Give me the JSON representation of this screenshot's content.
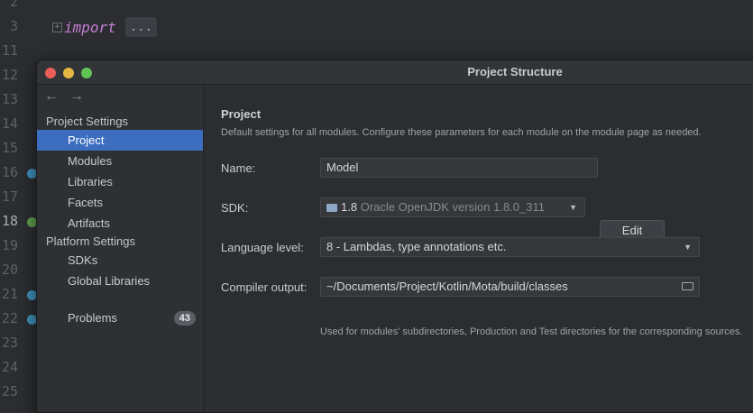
{
  "editor": {
    "line_numbers": [
      {
        "n": "2",
        "current": false
      },
      {
        "n": "3",
        "current": false
      },
      {
        "n": "11",
        "current": false
      },
      {
        "n": "12",
        "current": false
      },
      {
        "n": "13",
        "current": false
      },
      {
        "n": "14",
        "current": false
      },
      {
        "n": "15",
        "current": false
      },
      {
        "n": "16",
        "current": false
      },
      {
        "n": "17",
        "current": false
      },
      {
        "n": "18",
        "current": true
      },
      {
        "n": "19",
        "current": false
      },
      {
        "n": "20",
        "current": false
      },
      {
        "n": "21",
        "current": false
      },
      {
        "n": "22",
        "current": false
      },
      {
        "n": "23",
        "current": false
      },
      {
        "n": "24",
        "current": false
      },
      {
        "n": "25",
        "current": false
      }
    ],
    "import_keyword": "import",
    "collapsed_placeholder": "...",
    "gutter_markers": [
      "blue",
      "green",
      "blue",
      "blue"
    ]
  },
  "dialog": {
    "title": "Project Structure",
    "nav_back": "←",
    "nav_forward": "→",
    "sidebar": {
      "project_settings_header": "Project Settings",
      "project_items": [
        "Project",
        "Modules",
        "Libraries",
        "Facets",
        "Artifacts"
      ],
      "platform_settings_header": "Platform Settings",
      "platform_items": [
        "SDKs",
        "Global Libraries"
      ],
      "problems_label": "Problems",
      "problems_count": "43",
      "selected": "Project"
    },
    "content": {
      "heading": "Project",
      "description": "Default settings for all modules. Configure these parameters for each module on the module page as needed.",
      "name_label": "Name:",
      "name_value": "Model",
      "sdk_label": "SDK:",
      "sdk_version": "1.8",
      "sdk_detail": "Oracle OpenJDK version 1.8.0_311",
      "sdk_edit_button": "Edit",
      "language_level_label": "Language level:",
      "language_level_value": "8 - Lambdas, type annotations etc.",
      "compiler_output_label": "Compiler output:",
      "compiler_output_value": "~/Documents/Project/Kotlin/Mota/build/classes",
      "compiler_output_hint": "Used for modules' subdirectories, Production and Test directories for the corresponding sources."
    }
  },
  "colors": {
    "selection": "#3c6dbf",
    "keyword": "#c77dd6",
    "close": "#ec5f58",
    "minimize": "#e4b642",
    "zoom": "#5fc454"
  }
}
